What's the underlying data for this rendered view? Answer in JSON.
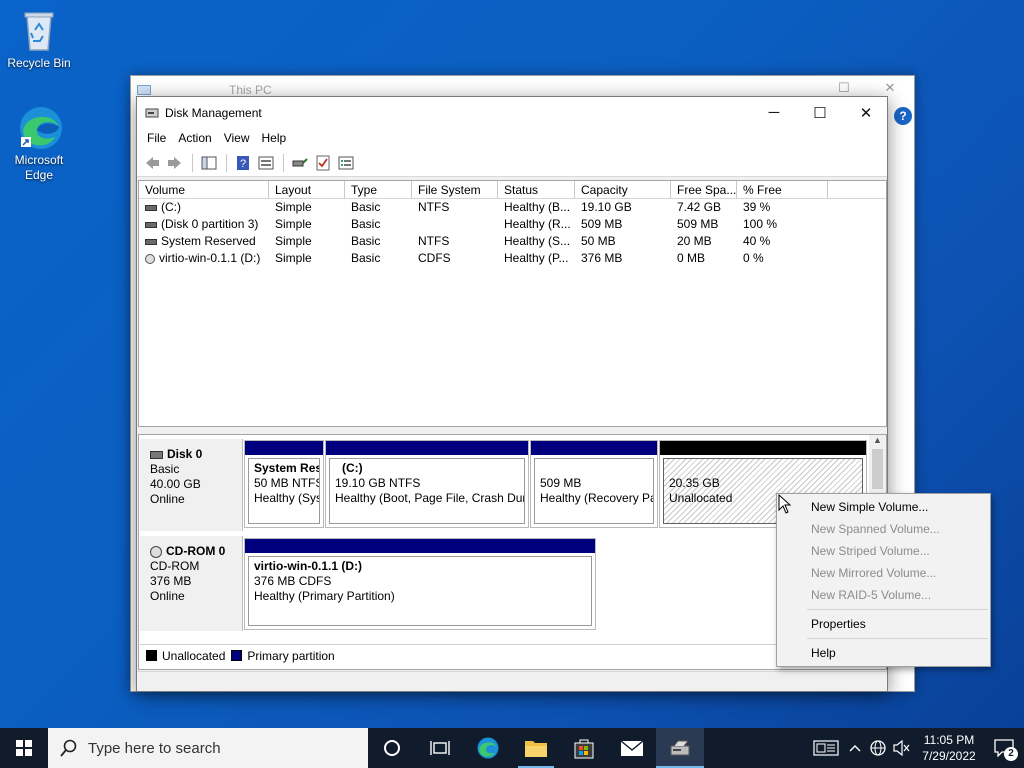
{
  "desktop": {
    "icons": [
      {
        "label": "Recycle Bin"
      },
      {
        "label": "Microsoft\nEdge"
      }
    ]
  },
  "bg_window": {
    "title": "This PC"
  },
  "window": {
    "title": "Disk Management",
    "menu": [
      "File",
      "Action",
      "View",
      "Help"
    ],
    "columns": [
      "Volume",
      "Layout",
      "Type",
      "File System",
      "Status",
      "Capacity",
      "Free Spa...",
      "% Free"
    ],
    "volumes": [
      [
        "(C:)",
        "Simple",
        "Basic",
        "NTFS",
        "Healthy (B...",
        "19.10 GB",
        "7.42 GB",
        "39 %"
      ],
      [
        "(Disk 0 partition 3)",
        "Simple",
        "Basic",
        "",
        "Healthy (R...",
        "509 MB",
        "509 MB",
        "100 %"
      ],
      [
        "System Reserved",
        "Simple",
        "Basic",
        "NTFS",
        "Healthy (S...",
        "50 MB",
        "20 MB",
        "40 %"
      ],
      [
        "virtio-win-0.1.1 (D:)",
        "Simple",
        "Basic",
        "CDFS",
        "Healthy (P...",
        "376 MB",
        "0 MB",
        "0 %"
      ]
    ],
    "disks": [
      {
        "name": "Disk 0",
        "type": "Basic",
        "size": "40.00 GB",
        "status": "Online",
        "partitions": [
          {
            "title": "System Res",
            "line2": "50 MB NTFS",
            "line3": "Healthy (Sys"
          },
          {
            "title": "(C:)",
            "line2": "19.10 GB NTFS",
            "line3": "Healthy (Boot, Page File, Crash Dum"
          },
          {
            "title": "",
            "line2": "509 MB",
            "line3": "Healthy (Recovery Pa"
          },
          {
            "title": "",
            "line2": "20.35 GB",
            "line3": "Unallocated"
          }
        ]
      },
      {
        "name": "CD-ROM 0",
        "type": "CD-ROM",
        "size": "376 MB",
        "status": "Online",
        "partitions": [
          {
            "title": "virtio-win-0.1.1  (D:)",
            "line2": "376 MB CDFS",
            "line3": "Healthy (Primary Partition)"
          }
        ]
      }
    ],
    "legend": [
      {
        "label": "Unallocated",
        "color": "#000000"
      },
      {
        "label": "Primary partition",
        "color": "#00007f"
      }
    ]
  },
  "context_menu": {
    "items": [
      {
        "label": "New Simple Volume...",
        "enabled": true
      },
      {
        "label": "New Spanned Volume...",
        "enabled": false
      },
      {
        "label": "New Striped Volume...",
        "enabled": false
      },
      {
        "label": "New Mirrored Volume...",
        "enabled": false
      },
      {
        "label": "New RAID-5 Volume...",
        "enabled": false
      },
      {
        "label": "Properties",
        "enabled": true
      },
      {
        "label": "Help",
        "enabled": true
      }
    ]
  },
  "taskbar": {
    "search_placeholder": "Type here to search",
    "time": "11:05 PM",
    "date": "7/29/2022",
    "notification_count": "2"
  }
}
